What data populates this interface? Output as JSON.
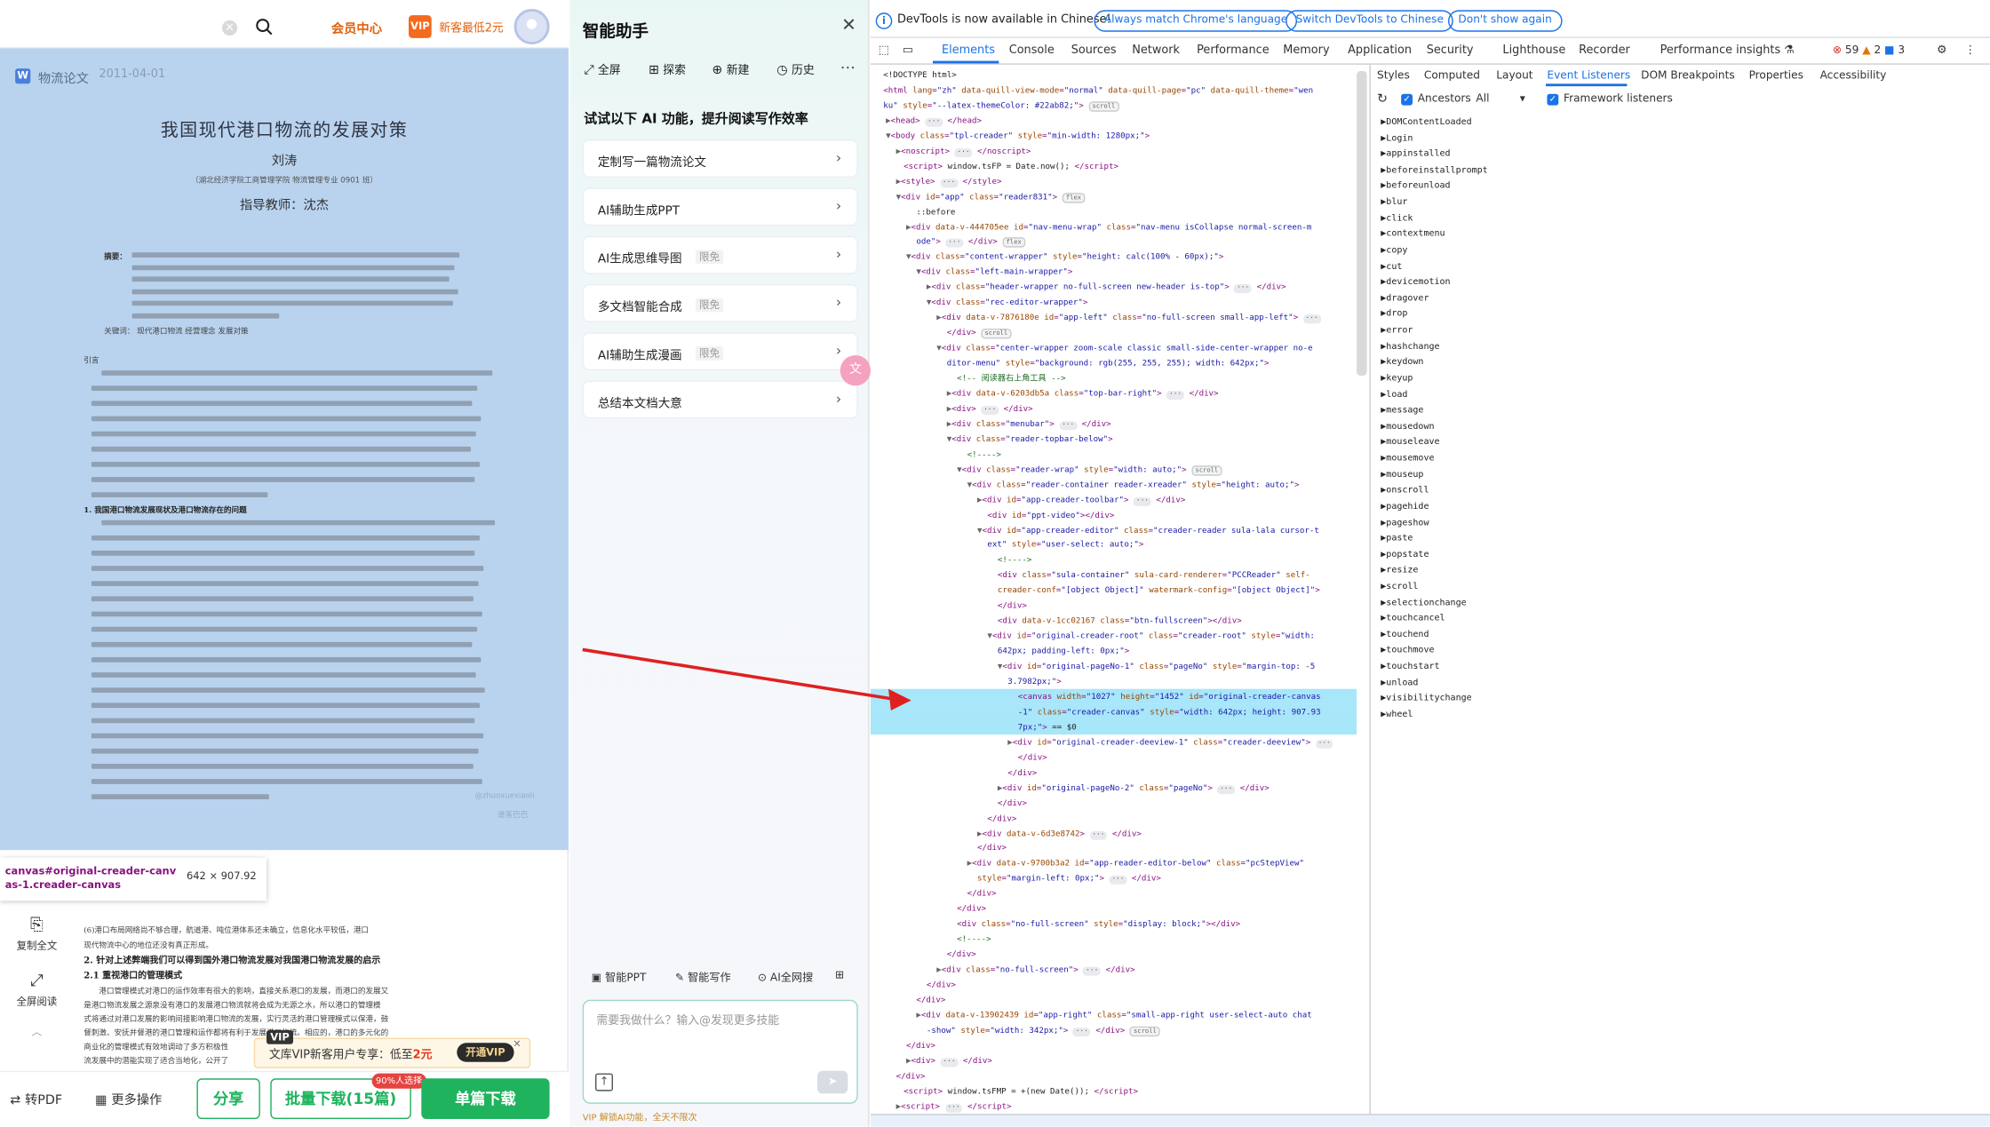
{
  "reader": {
    "topbar": {
      "search_placeholder": "",
      "vip_center": "会员中心",
      "vip_badge": "VIP",
      "new_customer": "新客最低2元"
    },
    "doc": {
      "tag": "物流论文",
      "date": "2011-04-01",
      "title": "我国现代港口物流的发展对策",
      "author": "刘涛",
      "affiliation": "（湖北经济学院工商管理学院 物流管理专业 0901 班）",
      "advisor": "指导教师：沈杰",
      "abstract_label": "摘要：",
      "keywords": "关键词：  现代港口物流     经营理念     发展对策",
      "intro_label": "引言",
      "section1": "1. 我国港口物流发展现状及港口物流存在的问题",
      "watermark": "@zhuoxuexiaoli",
      "watermark2": "道客巴巴"
    },
    "tooltip": {
      "selector": "canvas#original-creader-canvas-1.creader-canvas",
      "size": "642 × 907.92"
    },
    "page2": {
      "line1": "(6)港口布局网络尚不够合理，航道港、吨位港体系还未确立，信息化水平较低，港口",
      "line2": "现代物流中心的地位还没有真正形成。",
      "h2": "2. 针对上述弊端我们可以得到国外港口物流发展对我国港口物流发展的启示",
      "h3": "2.1 重视港口的管理模式",
      "line3": "港口管理模式对港口的运作效率有很大的影响，直接关系港口的发展，而港口的发展又",
      "line4": "是港口物流发展之源泉没有港口的发展港口物流就将会成为无源之水，所以港口的管理模",
      "line5": "式将通过对港口发展的影响间接影响港口物流的发展，实行灵活的港口管理模式以保港，鼓",
      "line6": "督刺激、安抚并督港的港口管理和运作都将有利于发展港口物流。相应的，港口的多元化的",
      "line7": "商业化的管理模式有效地调动了多方积极性",
      "line8": "流发展中的潜能实现了适合当地化，公开了"
    },
    "side_tools": [
      "复制全文",
      "全屏阅读"
    ],
    "vipbar": {
      "badge": "VIP",
      "text_pre": "文库VIP新客用户专享：低至",
      "price": "2元",
      "button": "开通VIP",
      "close": "×"
    },
    "bottom": {
      "to_pdf": "转PDF",
      "more_ops": "更多操作",
      "share": "分享",
      "batch": "批量下载(15篇)",
      "batch_badge": "90%人选择",
      "single": "单篇下载"
    }
  },
  "assistant": {
    "title": "智能助手",
    "tools": [
      "全屏",
      "探索",
      "新建",
      "历史"
    ],
    "subtitle": "试试以下 AI 功能，提升阅读写作效率",
    "cards": [
      {
        "label": "定制写一篇物流论文",
        "limit": ""
      },
      {
        "label": "AI辅助生成PPT",
        "limit": ""
      },
      {
        "label": "AI生成思维导图",
        "limit": "限免"
      },
      {
        "label": "多文档智能合成",
        "limit": "限免"
      },
      {
        "label": "AI辅助生成漫画",
        "limit": "限免"
      },
      {
        "label": "总结本文档大意",
        "limit": ""
      }
    ],
    "chips": [
      "智能PPT",
      "智能写作",
      "AI全网搜"
    ],
    "input_placeholder": "需要我做什么？输入@发现更多技能",
    "vip_strip": "VIP 解锁AI功能，全天不限次"
  },
  "devtools": {
    "banner": {
      "message": "DevTools is now available in Chinese!",
      "btn_match": "Always match Chrome's language",
      "btn_switch": "Switch DevTools to Chinese",
      "btn_dont": "Don't show again"
    },
    "tabs": [
      "Elements",
      "Console",
      "Sources",
      "Network",
      "Performance",
      "Memory",
      "Application",
      "Security",
      "Lighthouse",
      "Recorder",
      "Performance insights ⚗"
    ],
    "counts": {
      "errors": "59",
      "warnings": "2",
      "info": "3"
    },
    "side_tabs": [
      "Styles",
      "Computed",
      "Layout",
      "Event Listeners",
      "DOM Breakpoints",
      "Properties",
      "Accessibility"
    ],
    "options": {
      "ancestors": "Ancestors",
      "all": "All",
      "framework": "Framework listeners"
    },
    "events": [
      "DOMContentLoaded",
      "Login",
      "appinstalled",
      "beforeinstallprompt",
      "beforeunload",
      "blur",
      "click",
      "contextmenu",
      "copy",
      "cut",
      "devicemotion",
      "dragover",
      "drop",
      "error",
      "hashchange",
      "keydown",
      "keyup",
      "load",
      "message",
      "mousedown",
      "mouseleave",
      "mousemove",
      "mouseup",
      "onscroll",
      "pagehide",
      "pageshow",
      "paste",
      "popstate",
      "resize",
      "scroll",
      "selectionchange",
      "touchcancel",
      "touchend",
      "touchmove",
      "touchstart",
      "unload",
      "visibilitychange",
      "wheel"
    ]
  },
  "colors": {
    "accent_green": "#1fb35e",
    "devtools_blue": "#1a73e8",
    "highlight": "#a8e6fa",
    "reader_canvas": "#b9d3ef",
    "arrow": "#e02020"
  }
}
